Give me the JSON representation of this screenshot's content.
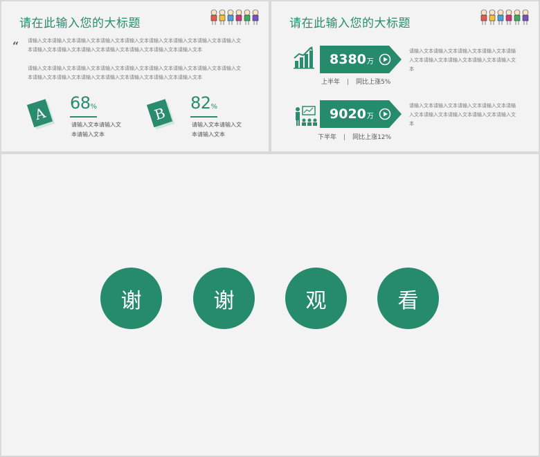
{
  "slide1": {
    "title": "请在此输入您的大标题",
    "quote_mark": "“",
    "paragraph1": "请输入文本请输入文本请输入文本请输入文本请输入文本请输入文本请输入文本请输入文本请输入文本请输入文本请输入文本请输入文本请输入文本请输入文本请输入文本请输入文本",
    "paragraph2": "请输入文本请输入文本请输入文本请输入文本请输入文本请输入文本请输入文本请输入文本请输入文本请输入文本请输入文本请输入文本请输入文本请输入文本请输入文本请输入文本",
    "book_a_letter": "A",
    "book_b_letter": "B",
    "percent_a": "68",
    "percent_b": "82",
    "percent_unit": "%",
    "desc_a": "请输入文本请输入文本请输入文本",
    "desc_b": "请输入文本请输入文本请输入文本",
    "colors": {
      "accent": "#2a8c6d"
    }
  },
  "slide2": {
    "title": "请在此输入您的大标题",
    "stat1": {
      "value": "8380",
      "unit": "万",
      "period": "上半年",
      "separator": "|",
      "change": "同比上涨5%",
      "icon": "growth-chart-icon"
    },
    "stat2": {
      "value": "9020",
      "unit": "万",
      "period": "下半年",
      "separator": "|",
      "change": "同比上涨12%",
      "icon": "presentation-icon"
    },
    "side_text1": "请输入文本请输入文本请输入文本请输入文本请输入文本请输入文本请输入文本请输入文本请输入文本",
    "side_text2": "请输入文本请输入文本请输入文本请输入文本请输入文本请输入文本请输入文本请输入文本请输入文本"
  },
  "slide3": {
    "chars": [
      "谢",
      "谢",
      "观",
      "看"
    ],
    "colors": {
      "circle": "#268b6b"
    }
  }
}
